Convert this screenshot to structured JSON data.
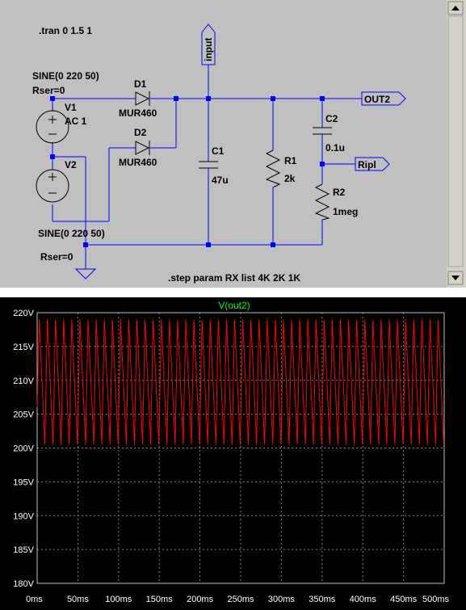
{
  "schematic": {
    "directives": {
      "tran": ".tran 0 1.5 1",
      "step": ".step param RX list 4K 2K 1K"
    },
    "v1": {
      "ref": "V1",
      "value": "AC 1",
      "spec": "SINE(0 220 50)",
      "rser": "Rser=0"
    },
    "v2": {
      "ref": "V2",
      "spec": "SINE(0 220 50)",
      "rser": "Rser=0"
    },
    "d1": {
      "ref": "D1",
      "part": "MUR460"
    },
    "d2": {
      "ref": "D2",
      "part": "MUR460"
    },
    "c1": {
      "ref": "C1",
      "value": "47u"
    },
    "c2": {
      "ref": "C2",
      "value": "0.1u"
    },
    "r1": {
      "ref": "R1",
      "value": "2k"
    },
    "r2": {
      "ref": "R2",
      "value": "1meg"
    },
    "labels": {
      "input": "input",
      "out2": "OUT2",
      "ripl": "Ripl"
    },
    "colors": {
      "background": "#c0c0c0",
      "wire": "#0000ff",
      "component": "#000000",
      "junction": "#0000ff"
    }
  },
  "plot": {
    "trace_name": "V(out2)",
    "colors": {
      "background": "#000000",
      "trace": "#ff0000",
      "grid": "#808080",
      "title": "#00ff00",
      "text": "#ffffff"
    },
    "chart_data": {
      "type": "line",
      "title": "V(out2)",
      "xlabel": "",
      "ylabel": "",
      "x_ticks": [
        "0ms",
        "50ms",
        "100ms",
        "150ms",
        "200ms",
        "250ms",
        "300ms",
        "350ms",
        "400ms",
        "450ms",
        "500ms"
      ],
      "y_ticks": [
        "220V",
        "215V",
        "210V",
        "205V",
        "200V",
        "195V",
        "190V",
        "185V",
        "180V"
      ],
      "xlim": [
        0,
        500
      ],
      "ylim": [
        180,
        220
      ],
      "grid": true,
      "series": [
        {
          "name": "V(out2)",
          "period_ms": 10,
          "peak_v": 219,
          "trough_v": 200.5,
          "initial_v": 206
        }
      ]
    }
  }
}
